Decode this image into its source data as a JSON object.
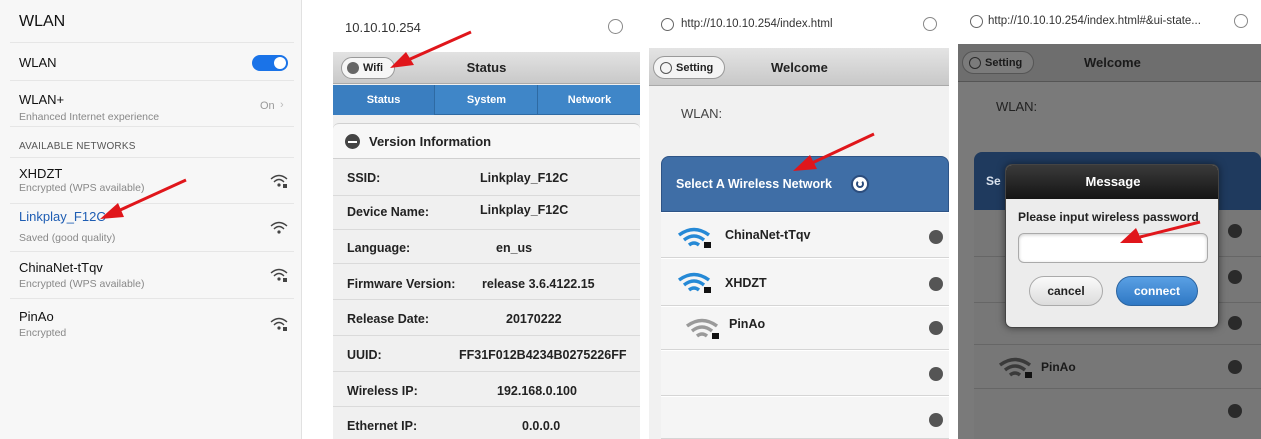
{
  "panel1": {
    "title": "WLAN",
    "wlan_label": "WLAN",
    "wlan_plus": {
      "label": "WLAN+",
      "sub": "Enhanced Internet experience",
      "value": "On"
    },
    "section_header": "AVAILABLE NETWORKS",
    "networks": [
      {
        "name": "XHDZT",
        "status": "Encrypted (WPS available)",
        "icon": "wifi-lock-icon"
      },
      {
        "name": "Linkplay_F12C",
        "status": "Saved (good quality)",
        "icon": "wifi-icon"
      },
      {
        "name": "ChinaNet-tTqv",
        "status": "Encrypted (WPS available)",
        "icon": "wifi-lock-icon"
      },
      {
        "name": "PinAo",
        "status": "Encrypted",
        "icon": "wifi-lock-icon"
      }
    ],
    "toggle_color": "#1a73e8",
    "selected_color": "#1e5db3"
  },
  "panel2": {
    "url": "10.10.10.254",
    "wifi_button": "Wifi",
    "header_title": "Status",
    "tabs": [
      "Status",
      "System",
      "Network"
    ],
    "section_title": "Version Information",
    "rows": [
      {
        "label": "SSID:",
        "value": "Linkplay_F12C"
      },
      {
        "label": "Device Name:",
        "value": "Linkplay_F12C"
      },
      {
        "label": "Language:",
        "value": "en_us"
      },
      {
        "label": "Firmware Version:",
        "value": "release 3.6.4122.15"
      },
      {
        "label": "Release Date:",
        "value": "20170222"
      },
      {
        "label": "UUID:",
        "value": "FF31F012B4234B0275226FF"
      },
      {
        "label": "Wireless IP:",
        "value": "192.168.0.100"
      },
      {
        "label": "Ethernet IP:",
        "value": "0.0.0.0"
      }
    ],
    "tab_color": "#3f86c8"
  },
  "panel3": {
    "url": "http://10.10.10.254/index.html",
    "setting_button": "Setting",
    "header_title": "Welcome",
    "wlan_label": "WLAN:",
    "select_network": "Select A Wireless Network",
    "networks": [
      "ChinaNet-tTqv",
      "XHDZT",
      "PinAo"
    ],
    "banner_color": "#3f6ea6"
  },
  "panel4": {
    "url": "http://10.10.10.254/index.html#&ui-state...",
    "setting_button": "Setting",
    "header_title": "Welcome",
    "wlan_label": "WLAN:",
    "select_prefix": "Se",
    "dialog": {
      "title": "Message",
      "prompt": "Please input wireless password",
      "password_value": "",
      "cancel": "cancel",
      "connect": "connect"
    },
    "networks": [
      "PinAo"
    ]
  },
  "arrow_color": "#e0161b"
}
